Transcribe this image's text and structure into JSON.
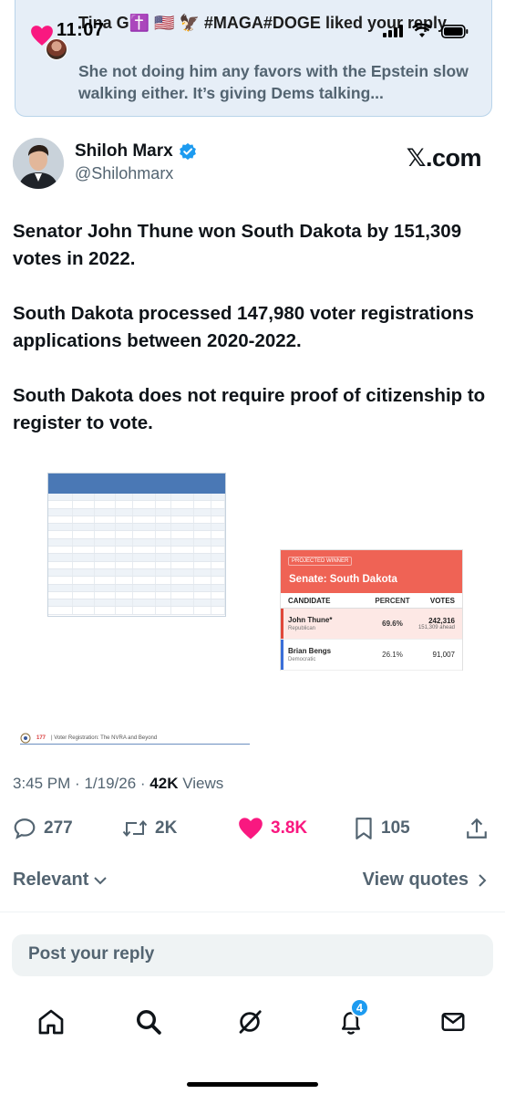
{
  "status_bar": {
    "time": "11:07"
  },
  "notification": {
    "title": "Tina G✝️ 🇺🇸 🦅 #MAGA#DOGE liked your reply",
    "body": "She not doing him any favors with the Epstein slow walking either. It’s giving Dems talking..."
  },
  "tweet": {
    "author_name": "Shiloh Marx",
    "author_handle": "@Shilohmarx",
    "source_label": "𝕏.com",
    "paragraphs": [
      "Senator John Thune won South Dakota by 151,309 votes in 2022.",
      "South Dakota processed 147,980 voter registrations applications between 2020-2022.",
      "South Dakota does not require proof of citizenship to register to vote."
    ],
    "time": "3:45 PM",
    "date": "1/19/26",
    "views_count": "42K",
    "views_label": "Views"
  },
  "election_card": {
    "badge": "PROJECTED WINNER",
    "title": "Senate: South Dakota",
    "columns": [
      "CANDIDATE",
      "PERCENT",
      "VOTES"
    ],
    "candidates": [
      {
        "name": "John Thune*",
        "party": "Republican",
        "percent": "69.6%",
        "votes": "242,316",
        "note": "151,309 ahead",
        "color": "#e0483b"
      },
      {
        "name": "Brian Bengs",
        "party": "Democratic",
        "percent": "26.1%",
        "votes": "91,007",
        "note": "",
        "color": "#3a6fd8"
      }
    ]
  },
  "doc_strip": {
    "page": "177",
    "text": "| Voter Registration: The NVRA and Beyond"
  },
  "actions": {
    "replies": "277",
    "reposts": "2K",
    "likes": "3.8K",
    "bookmarks": "105"
  },
  "sort_label": "Relevant",
  "view_quotes_label": "View quotes",
  "reply_placeholder": "Post your reply",
  "nav": {
    "notifications_badge": "4"
  },
  "colors": {
    "like": "#f91880",
    "verified": "#1d9bf0",
    "banner_bg": "#e6eef7"
  }
}
